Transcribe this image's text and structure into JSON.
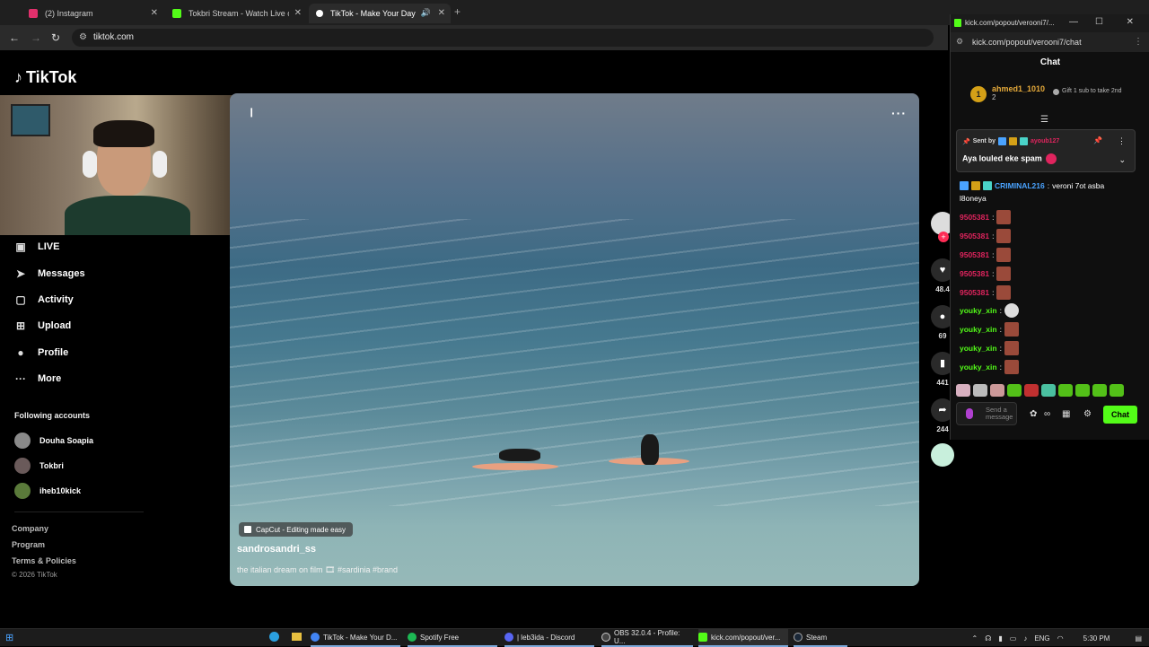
{
  "browser": {
    "tabs": [
      {
        "label": "(2) Instagram",
        "color": "#e1306c"
      },
      {
        "label": "Tokbri Stream - Watch Live on K",
        "color": "#53fc18"
      },
      {
        "label": "TikTok - Make Your Day",
        "color": "#ffffff",
        "active": true
      }
    ],
    "address": "tiktok.com"
  },
  "tiktok": {
    "logo": "TikTok",
    "nav": [
      {
        "label": "LIVE",
        "icon": "live-icon"
      },
      {
        "label": "Messages",
        "icon": "messages-icon"
      },
      {
        "label": "Activity",
        "icon": "activity-icon"
      },
      {
        "label": "Upload",
        "icon": "upload-icon"
      },
      {
        "label": "Profile",
        "icon": "profile-icon"
      },
      {
        "label": "More",
        "icon": "more-icon"
      }
    ],
    "following_title": "Following accounts",
    "following": [
      {
        "name": "Douha Soapia"
      },
      {
        "name": "Tokbri"
      },
      {
        "name": "iheb10kick"
      }
    ],
    "footer": [
      "Company",
      "Program",
      "Terms & Policies"
    ],
    "copyright": "© 2026 TikTok",
    "video": {
      "capcut": "CapCut - Editing made easy",
      "author": "sandrosandri_ss",
      "caption": "the italian dream on film 🎞 #sardinia #brand"
    },
    "actions": [
      {
        "icon": "heart-icon",
        "count": "48.4"
      },
      {
        "icon": "comment-icon",
        "count": "69"
      },
      {
        "icon": "bookmark-icon",
        "count": "441"
      },
      {
        "icon": "share-icon",
        "count": "244"
      }
    ]
  },
  "kick": {
    "window_title": "kick.com/popout/verooni7/...",
    "url": "kick.com/popout/verooni7/chat",
    "chat_title": "Chat",
    "leader": {
      "rank": "1",
      "name": "ahmed1_1010",
      "subs": "2"
    },
    "gift_tip": "Gift 1 sub to take 2nd",
    "pinned": {
      "sent_by": "Sent by",
      "user": "ayoub127",
      "message": "Aya louled eke spam"
    },
    "messages": [
      {
        "user": "CRIMINAL216",
        "color": "#4aa3ff",
        "text": "veroni 7ot asba",
        "text2": "l8oneya"
      },
      {
        "user": "9505381",
        "color": "#e0245e",
        "emote": true
      },
      {
        "user": "9505381",
        "color": "#e0245e",
        "emote": true
      },
      {
        "user": "9505381",
        "color": "#e0245e",
        "emote": true
      },
      {
        "user": "9505381",
        "color": "#e0245e",
        "emote": true
      },
      {
        "user": "9505381",
        "color": "#e0245e",
        "emote": true
      },
      {
        "user": "youky_xin",
        "color": "#53fc18",
        "emote": true
      },
      {
        "user": "youky_xin",
        "color": "#53fc18",
        "emote": true
      },
      {
        "user": "youky_xin",
        "color": "#53fc18",
        "emote": true
      },
      {
        "user": "youky_xin",
        "color": "#53fc18",
        "emote": true
      }
    ],
    "input_placeholder": "Send a message",
    "send_label": "Chat"
  },
  "taskbar": {
    "items": [
      {
        "label": "TikTok - Make Your D...",
        "color": "#4285f4"
      },
      {
        "label": "Spotify Free",
        "color": "#1db954"
      },
      {
        "label": "| leb3ida - Discord",
        "color": "#5865f2"
      },
      {
        "label": "OBS 32.0.4 - Profile: U...",
        "color": "#444444"
      },
      {
        "label": "kick.com/popout/ver...",
        "color": "#53fc18"
      },
      {
        "label": "Steam",
        "color": "#1b2838"
      }
    ],
    "lang": "ENG",
    "time": "5:30 PM"
  }
}
